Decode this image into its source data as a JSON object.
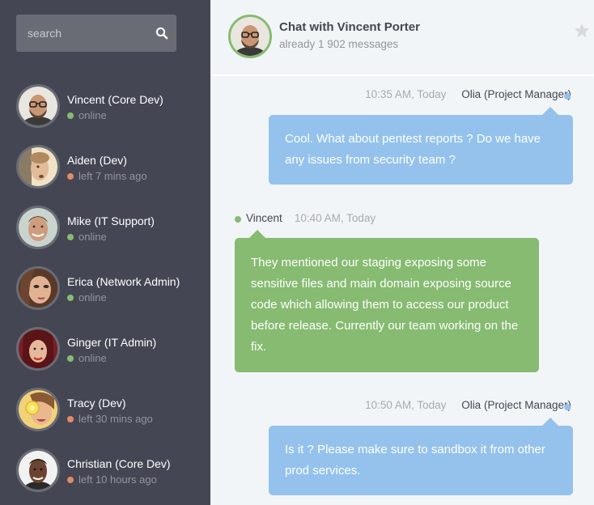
{
  "search": {
    "placeholder": "search",
    "icon": "search-icon"
  },
  "colors": {
    "online": "#86bb71",
    "away": "#e38968",
    "sidebar": "#444753",
    "incoming": "#94c2ed",
    "outgoing": "#86bb71"
  },
  "people": [
    {
      "name": "Vincent (Core Dev)",
      "status": "online",
      "state": "online"
    },
    {
      "name": "Aiden (Dev)",
      "status": "left 7 mins ago",
      "state": "away"
    },
    {
      "name": "Mike (IT Support)",
      "status": "online",
      "state": "online"
    },
    {
      "name": "Erica (Network Admin)",
      "status": "online",
      "state": "online"
    },
    {
      "name": "Ginger (IT Admin)",
      "status": "online",
      "state": "online"
    },
    {
      "name": "Tracy (Dev)",
      "status": "left 30 mins ago",
      "state": "away"
    },
    {
      "name": "Christian (Core Dev)",
      "status": "left 10 hours ago",
      "state": "away"
    }
  ],
  "header": {
    "title": "Chat with Vincent Porter",
    "subtitle": "already 1 902 messages",
    "star_icon": "star-icon"
  },
  "messages": [
    {
      "time": "10:35 AM, Today",
      "sender": "Olia (Project Manager)",
      "text": "Cool. What about pentest reports ? Do we have any issues from security team ?"
    },
    {
      "time": "10:40 AM, Today",
      "sender": "Vincent",
      "text": "They mentioned our staging exposing some sensitive files and main domain exposing source code which allowing them to access our product before release. Currently our team working on the fix."
    },
    {
      "time": "10:50 AM, Today",
      "sender": "Olia (Project Manager)",
      "text": "Is it ? Please make sure to sandbox it from other prod services."
    }
  ]
}
